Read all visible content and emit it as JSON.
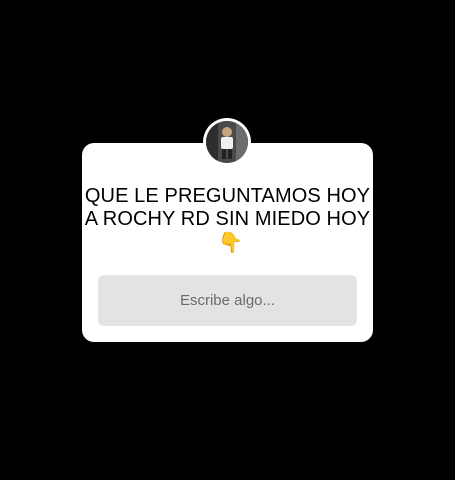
{
  "question_sticker": {
    "question": "QUE LE PREGUNTAMOS HOY A ROCHY RD SIN MIEDO HOY",
    "emoji": "👇",
    "answer_placeholder": "Escribe algo..."
  },
  "avatar": {
    "icon": "profile-photo"
  },
  "colors": {
    "background": "#000000",
    "card": "#ffffff",
    "field": "#e3e3e3",
    "placeholder": "#6b6b6b"
  }
}
